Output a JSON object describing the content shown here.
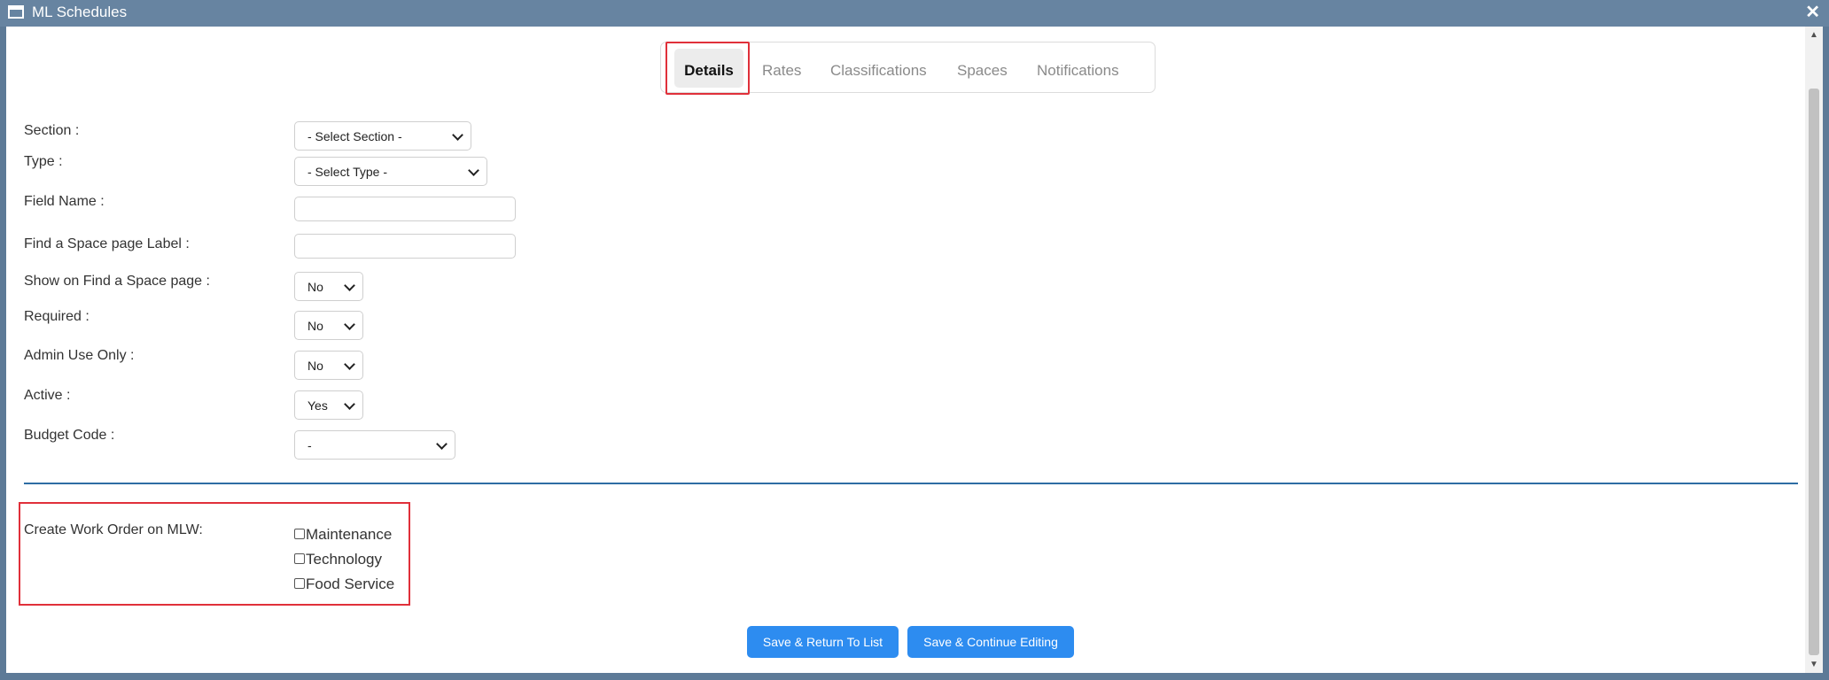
{
  "window": {
    "title": "ML Schedules",
    "close_glyph": "✕"
  },
  "tabs": [
    {
      "label": "Details",
      "active": true
    },
    {
      "label": "Rates"
    },
    {
      "label": "Classifications"
    },
    {
      "label": "Spaces"
    },
    {
      "label": "Notifications"
    }
  ],
  "form": {
    "section": {
      "label": "Section :",
      "value": "- Select Section -"
    },
    "type": {
      "label": "Type :",
      "value": "- Select Type -"
    },
    "field_name": {
      "label": "Field Name :",
      "value": ""
    },
    "find_label": {
      "label": "Find a Space page Label :",
      "value": ""
    },
    "show_on_find": {
      "label": "Show on Find a Space page :",
      "value": "No"
    },
    "required": {
      "label": "Required :",
      "value": "No"
    },
    "admin_only": {
      "label": "Admin Use Only :",
      "value": "No"
    },
    "active": {
      "label": "Active :",
      "value": "Yes"
    },
    "budget_code": {
      "label": "Budget Code :",
      "value": "-"
    }
  },
  "work_order": {
    "label": "Create Work Order on MLW:",
    "options": [
      {
        "label": "Maintenance",
        "checked": false
      },
      {
        "label": "Technology",
        "checked": false
      },
      {
        "label": "Food Service",
        "checked": false
      }
    ]
  },
  "buttons": {
    "save_return": "Save & Return To List",
    "save_continue": "Save & Continue Editing"
  },
  "colors": {
    "accent": "#2d8cf0",
    "highlight": "#e0303a",
    "titlebar": "#6784a1",
    "divider": "#2e6da4"
  },
  "icons": {
    "window": "window-icon",
    "close": "close-icon",
    "chevron": "chevron-down-icon"
  }
}
